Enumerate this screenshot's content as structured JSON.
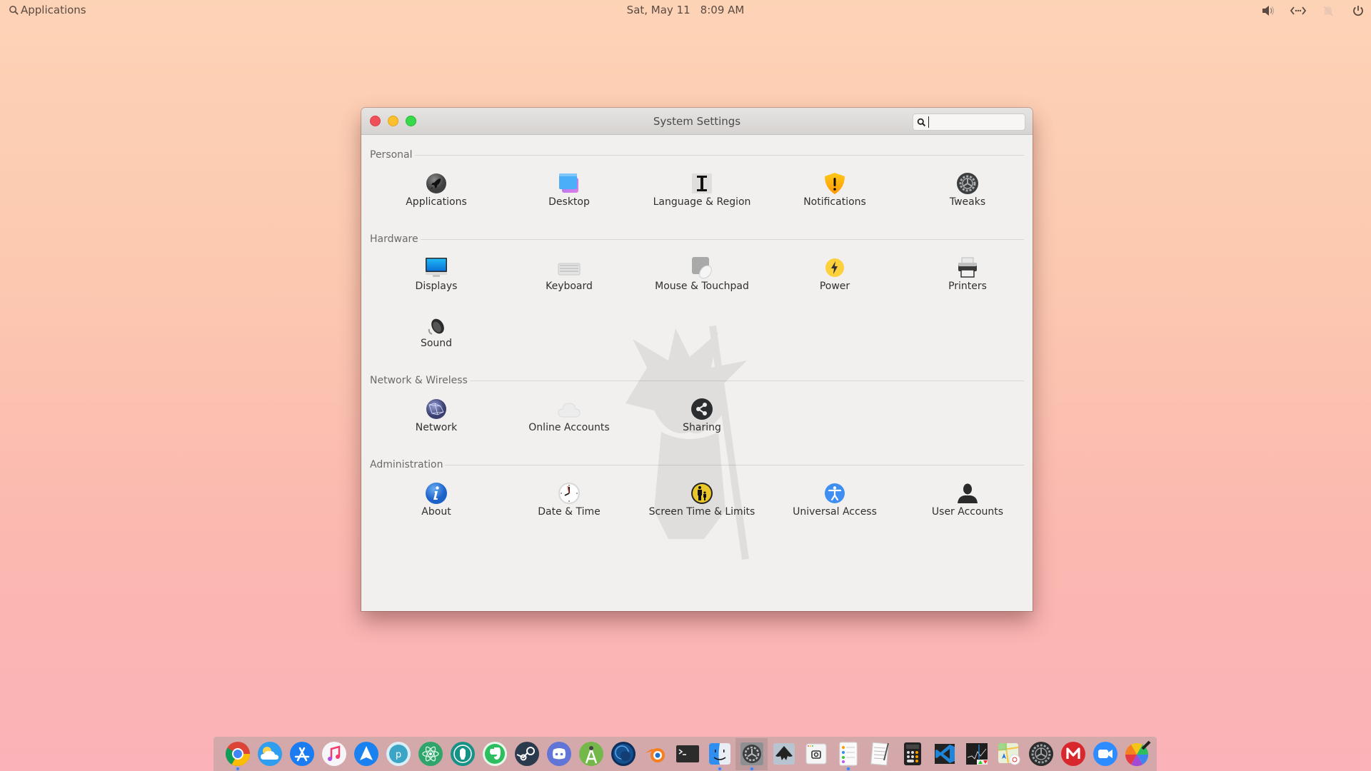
{
  "top_panel": {
    "apps_label": "Applications",
    "date": "Sat, May 11",
    "time": "8:09 AM",
    "indicators": [
      "volume-icon",
      "network-wired-icon",
      "notifications-muted-icon",
      "power-icon"
    ]
  },
  "window": {
    "title": "System Settings",
    "search": {
      "value": "",
      "placeholder": ""
    },
    "sections": [
      {
        "title": "Personal",
        "items": [
          {
            "label": "Applications",
            "icon": "rocket-icon"
          },
          {
            "label": "Desktop",
            "icon": "desktop-windows-icon"
          },
          {
            "label": "Language & Region",
            "icon": "language-icon"
          },
          {
            "label": "Notifications",
            "icon": "notifications-shield-icon"
          },
          {
            "label": "Tweaks",
            "icon": "tweaks-gear-icon"
          }
        ]
      },
      {
        "title": "Hardware",
        "items": [
          {
            "label": "Displays",
            "icon": "monitor-icon"
          },
          {
            "label": "Keyboard",
            "icon": "keyboard-icon"
          },
          {
            "label": "Mouse & Touchpad",
            "icon": "mouse-touchpad-icon"
          },
          {
            "label": "Power",
            "icon": "power-bolt-icon"
          },
          {
            "label": "Printers",
            "icon": "printer-icon"
          },
          {
            "label": "Sound",
            "icon": "speaker-icon"
          }
        ]
      },
      {
        "title": "Network & Wireless",
        "items": [
          {
            "label": "Network",
            "icon": "globe-network-icon"
          },
          {
            "label": "Online Accounts",
            "icon": "cloud-icon"
          },
          {
            "label": "Sharing",
            "icon": "share-icon"
          }
        ]
      },
      {
        "title": "Administration",
        "items": [
          {
            "label": "About",
            "icon": "info-icon"
          },
          {
            "label": "Date & Time",
            "icon": "clock-icon"
          },
          {
            "label": "Screen Time & Limits",
            "icon": "parental-controls-icon"
          },
          {
            "label": "Universal Access",
            "icon": "accessibility-icon"
          },
          {
            "label": "User Accounts",
            "icon": "user-icon"
          }
        ]
      }
    ]
  },
  "dock": {
    "items": [
      {
        "name": "Chrome",
        "icon": "chrome-icon",
        "running": true
      },
      {
        "name": "Weather",
        "icon": "weather-icon",
        "running": false
      },
      {
        "name": "App Store",
        "icon": "app-store-icon",
        "running": false
      },
      {
        "name": "Music",
        "icon": "music-icon",
        "running": false
      },
      {
        "name": "Send",
        "icon": "paper-plane-icon",
        "running": false
      },
      {
        "name": "Podman",
        "icon": "podman-icon",
        "running": false
      },
      {
        "name": "Atom",
        "icon": "atom-icon",
        "running": false
      },
      {
        "name": "GitKraken",
        "icon": "gitkraken-icon",
        "running": false
      },
      {
        "name": "Evernote",
        "icon": "evernote-icon",
        "running": false
      },
      {
        "name": "Steam",
        "icon": "steam-icon",
        "running": false
      },
      {
        "name": "Discord",
        "icon": "discord-icon",
        "running": false
      },
      {
        "name": "Android Studio",
        "icon": "android-studio-icon",
        "running": false
      },
      {
        "name": "Eclipse",
        "icon": "eclipse-icon",
        "running": false
      },
      {
        "name": "Blender",
        "icon": "blender-icon",
        "running": false
      },
      {
        "name": "Terminal",
        "icon": "terminal-icon",
        "running": false
      },
      {
        "name": "Files",
        "icon": "finder-icon",
        "running": true
      },
      {
        "name": "System Settings",
        "icon": "settings-icon",
        "running": true,
        "active": true
      },
      {
        "name": "Inkscape",
        "icon": "inkscape-icon",
        "running": false
      },
      {
        "name": "Screenshot",
        "icon": "screenshot-icon",
        "running": false
      },
      {
        "name": "Reminders",
        "icon": "reminders-icon",
        "running": true
      },
      {
        "name": "Text Editor",
        "icon": "text-editor-icon",
        "running": false
      },
      {
        "name": "Calculator",
        "icon": "calculator-icon",
        "running": false
      },
      {
        "name": "VS Code",
        "icon": "vscode-icon",
        "running": false
      },
      {
        "name": "System Monitor",
        "icon": "stocks-icon",
        "running": false
      },
      {
        "name": "Maps",
        "icon": "maps-icon",
        "running": false
      },
      {
        "name": "Settings",
        "icon": "gear-icon",
        "running": false
      },
      {
        "name": "MEGA",
        "icon": "mega-icon",
        "running": false
      },
      {
        "name": "Zoom",
        "icon": "video-call-icon",
        "running": false
      },
      {
        "name": "Color Picker",
        "icon": "color-picker-icon",
        "running": false
      }
    ]
  }
}
